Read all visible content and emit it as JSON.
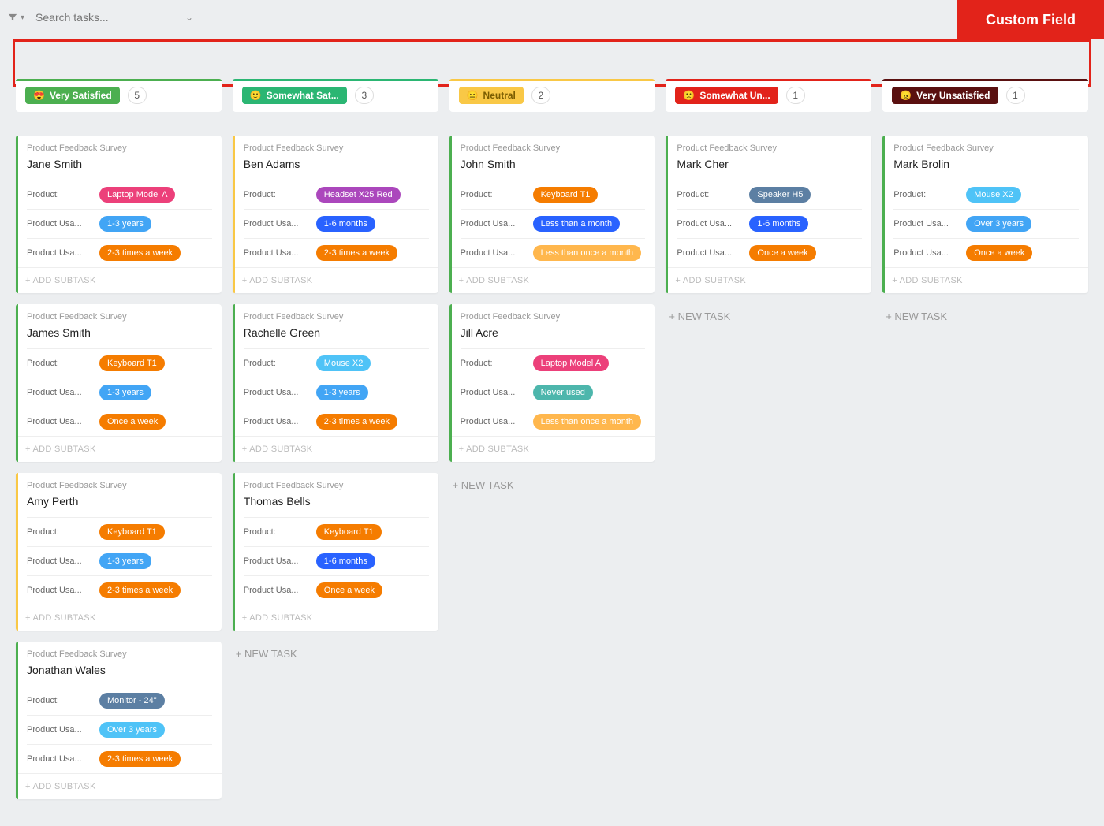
{
  "topbar": {
    "search_placeholder": "Search tasks..."
  },
  "custom_field_label": "Custom Field",
  "add_subtask_label": "+ ADD SUBTASK",
  "new_task_label": "+ NEW TASK",
  "survey_label": "Product Feedback Survey",
  "fields": {
    "product": "Product:",
    "usage_duration": "Product Usa...",
    "usage_freq": "Product Usa..."
  },
  "columns": [
    {
      "status": "Very Satisfied",
      "emoji": "😍",
      "count": "5",
      "status_class": "s-green",
      "accent_class": "accent-green",
      "cards": [
        {
          "name": "Jane Smith",
          "stripe": "stripe-green",
          "product": {
            "text": "Laptop Model A",
            "cls": "c-pink"
          },
          "dur": {
            "text": "1-3 years",
            "cls": "c-sky"
          },
          "freq": {
            "text": "2-3 times a week",
            "cls": "c-orange"
          }
        },
        {
          "name": "James Smith",
          "stripe": "stripe-green",
          "product": {
            "text": "Keyboard T1",
            "cls": "c-orange"
          },
          "dur": {
            "text": "1-3 years",
            "cls": "c-sky"
          },
          "freq": {
            "text": "Once a week",
            "cls": "c-orange"
          }
        },
        {
          "name": "Amy Perth",
          "stripe": "stripe-yellow",
          "product": {
            "text": "Keyboard T1",
            "cls": "c-orange"
          },
          "dur": {
            "text": "1-3 years",
            "cls": "c-sky"
          },
          "freq": {
            "text": "2-3 times a week",
            "cls": "c-orange"
          }
        },
        {
          "name": "Jonathan Wales",
          "stripe": "stripe-green",
          "product": {
            "text": "Monitor - 24\"",
            "cls": "c-steel"
          },
          "dur": {
            "text": "Over 3 years",
            "cls": "c-ltsky"
          },
          "freq": {
            "text": "2-3 times a week",
            "cls": "c-orange"
          }
        }
      ]
    },
    {
      "status": "Somewhat Sat...",
      "emoji": "🙂",
      "count": "3",
      "status_class": "s-lime",
      "accent_class": "accent-lime",
      "cards": [
        {
          "name": "Ben Adams",
          "stripe": "stripe-yellow",
          "product": {
            "text": "Headset X25 Red",
            "cls": "c-purple"
          },
          "dur": {
            "text": "1-6 months",
            "cls": "c-blue"
          },
          "freq": {
            "text": "2-3 times a week",
            "cls": "c-orange"
          }
        },
        {
          "name": "Rachelle Green",
          "stripe": "stripe-green",
          "product": {
            "text": "Mouse X2",
            "cls": "c-ltsky"
          },
          "dur": {
            "text": "1-3 years",
            "cls": "c-sky"
          },
          "freq": {
            "text": "2-3 times a week",
            "cls": "c-orange"
          }
        },
        {
          "name": "Thomas Bells",
          "stripe": "stripe-green",
          "product": {
            "text": "Keyboard T1",
            "cls": "c-orange"
          },
          "dur": {
            "text": "1-6 months",
            "cls": "c-blue"
          },
          "freq": {
            "text": "Once a week",
            "cls": "c-orange"
          }
        }
      ],
      "new_task": true
    },
    {
      "status": "Neutral",
      "emoji": "😐",
      "count": "2",
      "status_class": "s-yellow",
      "accent_class": "accent-yellow",
      "cards": [
        {
          "name": "John Smith",
          "stripe": "stripe-green",
          "product": {
            "text": "Keyboard T1",
            "cls": "c-orange"
          },
          "dur": {
            "text": "Less than a month",
            "cls": "c-blue"
          },
          "freq": {
            "text": "Less than once a month",
            "cls": "c-ltorange"
          }
        },
        {
          "name": "Jill Acre",
          "stripe": "stripe-green",
          "product": {
            "text": "Laptop Model A",
            "cls": "c-pink"
          },
          "dur": {
            "text": "Never used",
            "cls": "c-teal"
          },
          "freq": {
            "text": "Less than once a month",
            "cls": "c-ltorange"
          }
        }
      ],
      "new_task": true
    },
    {
      "status": "Somewhat Un...",
      "emoji": "🙁",
      "count": "1",
      "status_class": "s-red",
      "accent_class": "accent-red",
      "cards": [
        {
          "name": "Mark Cher",
          "stripe": "stripe-green",
          "product": {
            "text": "Speaker H5",
            "cls": "c-steel"
          },
          "dur": {
            "text": "1-6 months",
            "cls": "c-blue"
          },
          "freq": {
            "text": "Once a week",
            "cls": "c-orange"
          }
        }
      ],
      "new_task": true
    },
    {
      "status": "Very Unsatisfied",
      "emoji": "😠",
      "count": "1",
      "status_class": "s-dark",
      "accent_class": "accent-dark",
      "cards": [
        {
          "name": "Mark Brolin",
          "stripe": "stripe-green",
          "product": {
            "text": "Mouse X2",
            "cls": "c-ltsky"
          },
          "dur": {
            "text": "Over 3 years",
            "cls": "c-sky"
          },
          "freq": {
            "text": "Once a week",
            "cls": "c-orange"
          }
        }
      ],
      "new_task": true
    }
  ]
}
